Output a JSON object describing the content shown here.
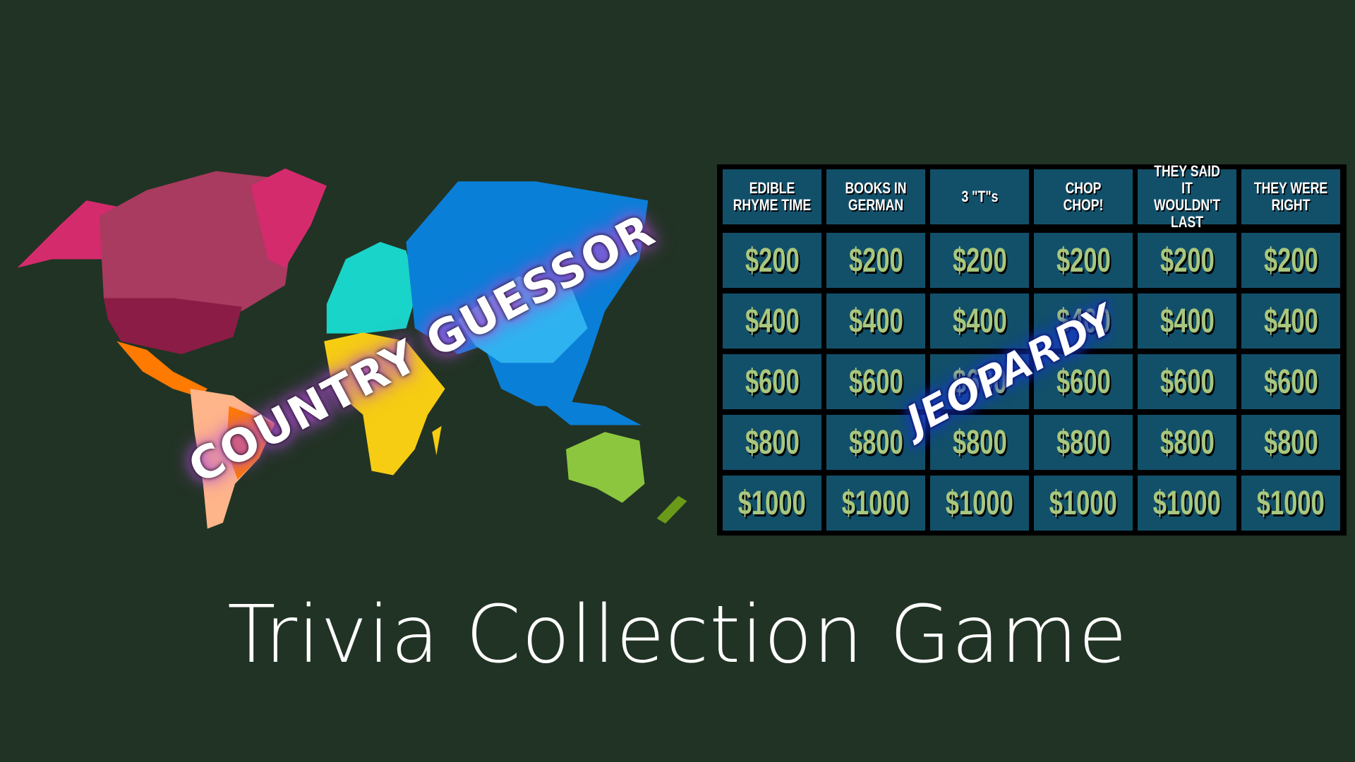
{
  "map_overlay_label": "COUNTRY GUESSOR",
  "board_overlay_label": "JEOPARDY",
  "title": "Trivia Collection Game",
  "board": {
    "categories": [
      "EDIBLE RHYME TIME",
      "BOOKS IN GERMAN",
      "3 \"T\"s",
      "CHOP CHOP!",
      "THEY SAID IT WOULDN'T LAST",
      "THEY WERE RIGHT"
    ],
    "values": [
      "$200",
      "$400",
      "$600",
      "$800",
      "$1000"
    ]
  },
  "colors": {
    "background": "#213324",
    "cell": "#12506a",
    "money": "#a9c77e"
  }
}
